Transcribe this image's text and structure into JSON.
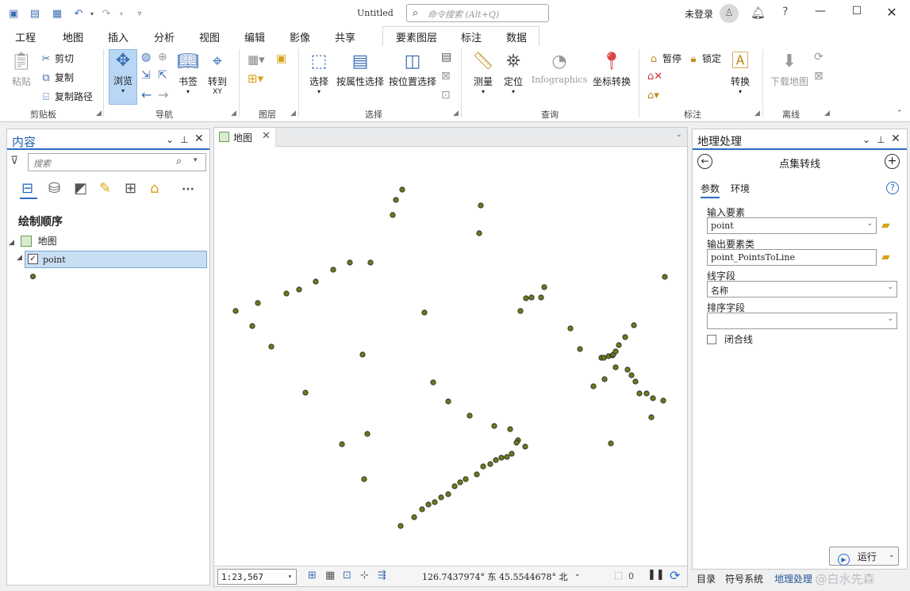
{
  "window": {
    "title": "Untitled",
    "search_placeholder": "命令搜索 (Alt+Q)",
    "user_status": "未登录",
    "help": "?"
  },
  "ribbon_tabs": [
    "工程",
    "地图",
    "插入",
    "分析",
    "视图",
    "编辑",
    "影像",
    "共享"
  ],
  "active_tab": "地图",
  "context_tabs": [
    "要素图层",
    "标注",
    "数据"
  ],
  "ribbon": {
    "clipboard": {
      "paste": "粘贴",
      "cut": "剪切",
      "copy": "复制",
      "copy_path": "复制路径",
      "label": "剪贴板"
    },
    "navigate": {
      "explore": "浏览",
      "bookmarks": "书签",
      "goto": "转到",
      "goto_sub": "XY",
      "label": "导航"
    },
    "layer": {
      "label": "图层"
    },
    "selection": {
      "select": "选择",
      "by_attr": "按属性选择",
      "by_loc": "按位置选择",
      "label": "选择"
    },
    "inquiry": {
      "measure": "测量",
      "locate": "定位",
      "infographics": "Infographics",
      "convert_coord": "坐标转换",
      "label": "查询"
    },
    "labeling": {
      "pause": "暂停",
      "lock": "锁定",
      "convert": "转换",
      "label": "标注"
    },
    "offline": {
      "download": "下载地图",
      "label": "离线"
    }
  },
  "contents": {
    "title": "内容",
    "search_placeholder": "搜索",
    "draw_order": "绘制顺序",
    "map_node": "地图",
    "layer_name": "point",
    "more": "···"
  },
  "map": {
    "tab_label": "地图",
    "scale": "1:23,567",
    "coords": "126.7437974° 东 45.5544678° 北",
    "selected_count": "0",
    "point_color": "#6b7a1e"
  },
  "geoprocessing": {
    "title": "地理处理",
    "tool_name": "点集转线",
    "tab_params": "参数",
    "tab_env": "环境",
    "input_label": "输入要素",
    "input_value": "point",
    "output_label": "输出要素类",
    "output_value": "point_PointsToLine",
    "line_field_label": "线字段",
    "line_field_value": "名称",
    "sort_field_label": "排序字段",
    "sort_field_value": "",
    "close_line_label": "闭合线",
    "run_label": "运行"
  },
  "bottom_tabs": [
    "目录",
    "符号系统",
    "地理处理"
  ],
  "active_bottom_tab": "地理处理",
  "watermark": "CSDN @白水先森"
}
